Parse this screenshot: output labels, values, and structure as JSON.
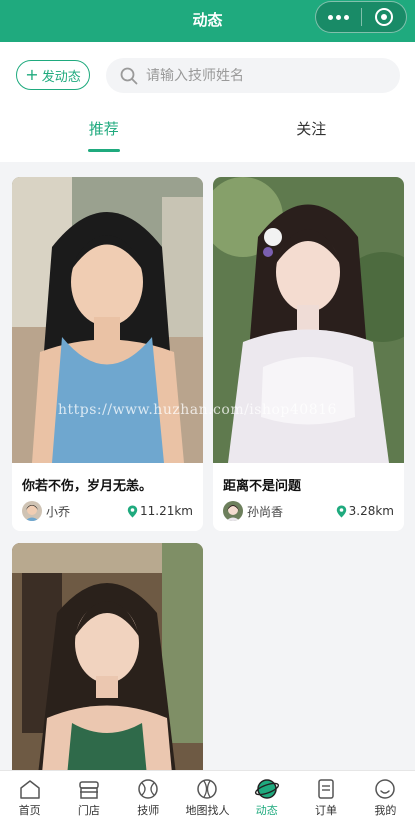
{
  "header": {
    "title": "动态"
  },
  "toolbar": {
    "post_label": "发动态",
    "search_placeholder": "请输入技师姓名",
    "search_value": ""
  },
  "tabs": [
    {
      "label": "推荐",
      "active": true
    },
    {
      "label": "关注",
      "active": false
    }
  ],
  "posts": [
    {
      "caption": "你若不伤，岁月无恙。",
      "author": "小乔",
      "distance": "11.21km"
    },
    {
      "caption": "距离不是问题",
      "author": "孙尚香",
      "distance": "3.28km"
    },
    {
      "caption": "",
      "author": "",
      "distance": ""
    }
  ],
  "watermark": "https://www.huzhan.com/ishop40816",
  "nav": [
    {
      "label": "首页",
      "icon": "home-icon"
    },
    {
      "label": "门店",
      "icon": "store-icon"
    },
    {
      "label": "技师",
      "icon": "technician-icon"
    },
    {
      "label": "地图找人",
      "icon": "map-icon"
    },
    {
      "label": "动态",
      "icon": "moments-icon",
      "active": true
    },
    {
      "label": "订单",
      "icon": "order-icon"
    },
    {
      "label": "我的",
      "icon": "profile-icon"
    }
  ],
  "colors": {
    "accent": "#1faa7e",
    "background": "#f3f4f6"
  }
}
